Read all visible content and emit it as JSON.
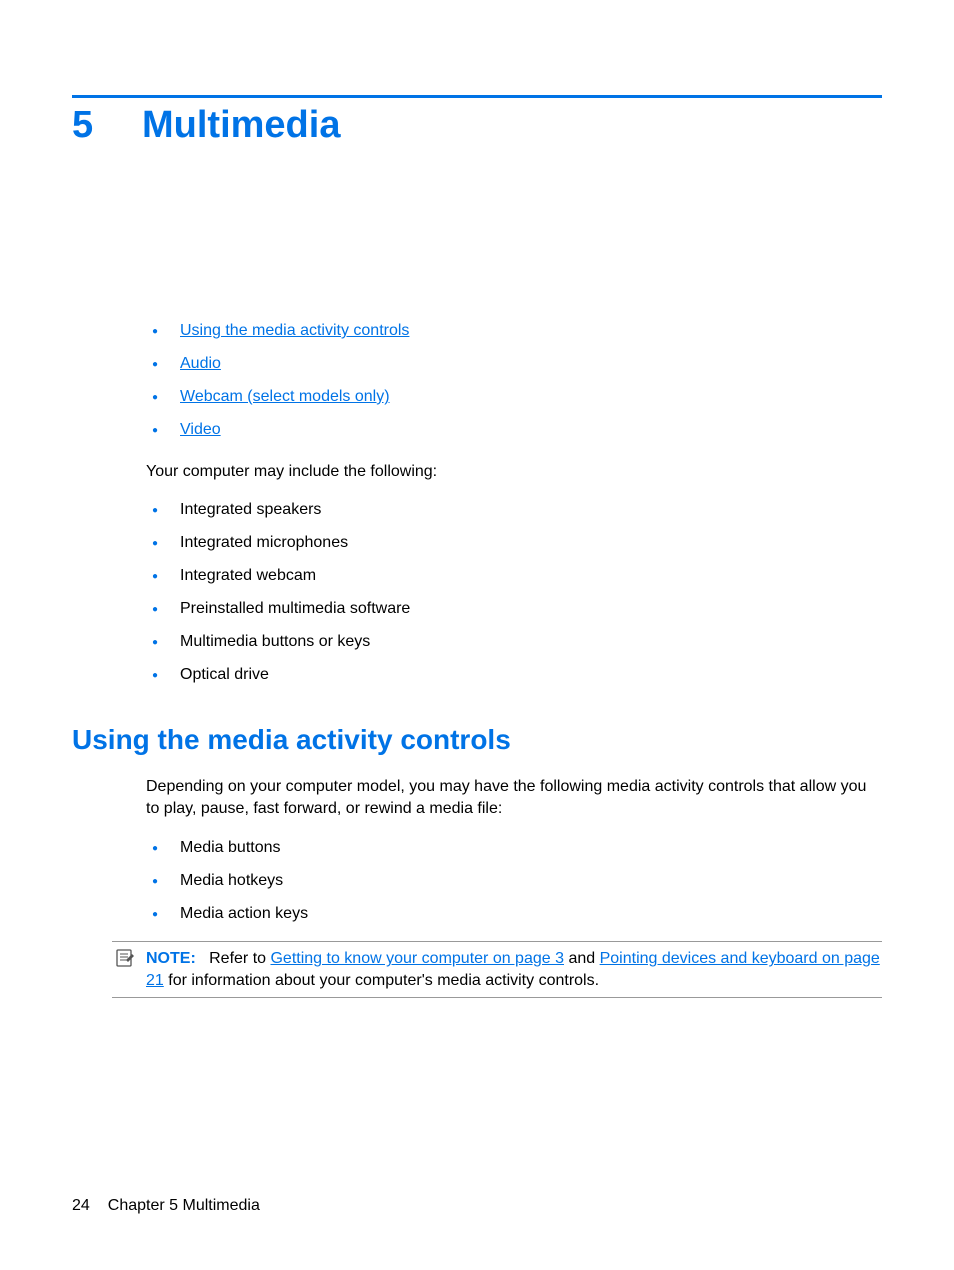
{
  "chapter": {
    "number": "5",
    "title": "Multimedia"
  },
  "toc": {
    "items": [
      "Using the media activity controls",
      "Audio",
      "Webcam (select models only)",
      "Video"
    ]
  },
  "intro": "Your computer may include the following:",
  "features": [
    "Integrated speakers",
    "Integrated microphones",
    "Integrated webcam",
    "Preinstalled multimedia software",
    "Multimedia buttons or keys",
    "Optical drive"
  ],
  "section": {
    "heading": "Using the media activity controls",
    "body": "Depending on your computer model, you may have the following media activity controls that allow you to play, pause, fast forward, or rewind a media file:",
    "items": [
      "Media buttons",
      "Media hotkeys",
      "Media action keys"
    ]
  },
  "note": {
    "label": "NOTE:",
    "pre": "Refer to ",
    "link1": "Getting to know your computer on page 3",
    "mid": " and ",
    "link2": "Pointing devices and keyboard on page 21",
    "post": " for information about your computer's media activity controls."
  },
  "footer": {
    "page": "24",
    "chapter_label": "Chapter 5   Multimedia"
  }
}
